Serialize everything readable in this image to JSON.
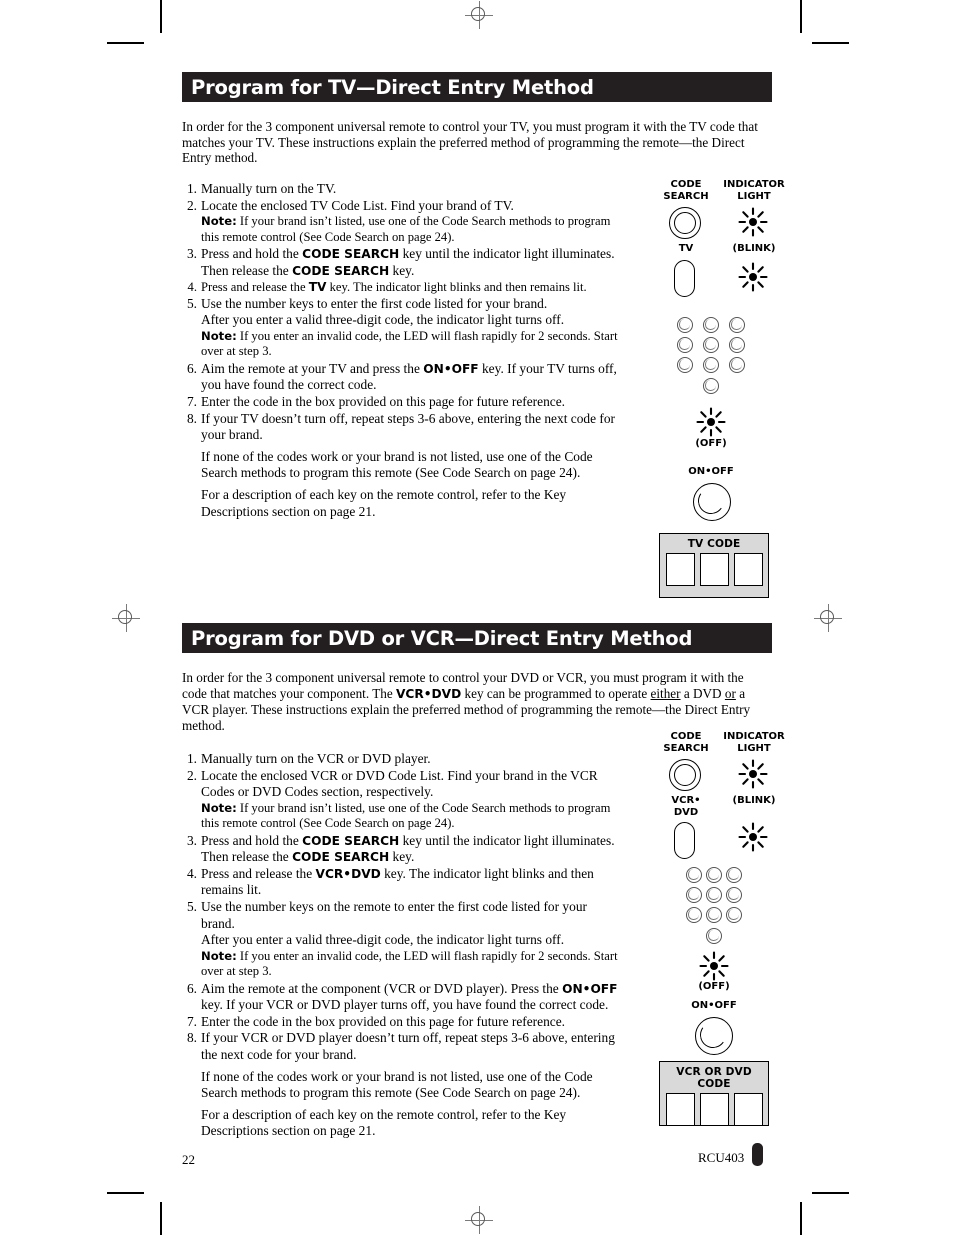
{
  "document": {
    "page_number": "22",
    "model": "RCU403"
  },
  "sections": [
    {
      "id": "tv",
      "header": "Program for TV—Direct Entry Method",
      "intro": "In order for the 3 component universal remote to control your TV, you must program it with the TV code that matches your TV. These instructions explain the preferred method of programming the remote—the Direct Entry method.",
      "steps": [
        {
          "num": "1.",
          "text": "Manually turn on the TV."
        },
        {
          "num": "2.",
          "text": "Locate the enclosed TV Code List. Find your brand of TV."
        },
        {
          "num": "",
          "note_label": "Note:",
          "text": "If your brand isn't listed, use one of the Code Search methods to program this remote control (See Code Search on page 24)."
        },
        {
          "num": "3.",
          "text": "Press and hold the CODE SEARCH key until the indicator light illuminates. Then release the CODE SEARCH key."
        },
        {
          "num": "4.",
          "text": "Press and release the TV key. The indicator light blinks and then remains lit."
        },
        {
          "num": "5.",
          "text": "Use the number keys to enter the first code listed for your brand."
        },
        {
          "num": "",
          "text": "After you enter a valid three-digit code, the indicator light turns off."
        },
        {
          "num": "",
          "note_label": "Note:",
          "text": "If you enter an invalid code, the LED will flash rapidly for 2 seconds. Start over at step 3."
        },
        {
          "num": "6.",
          "text": "Aim the remote at your TV and press the ON•OFF key. If your TV turns off, you have found the correct code."
        },
        {
          "num": "7.",
          "text": "Enter the code in the box provided on this page for future reference."
        },
        {
          "num": "8.",
          "text": "If your TV doesn't turn off, repeat steps 3-6 above, entering the next code for your brand."
        },
        {
          "num": "",
          "text": "If none of the codes work or your brand is not listed, use one of the Code Search methods to program this remote (See Code Search on page 24)."
        },
        {
          "num": "",
          "text": "For a description of each key on the remote control, refer to the Key Descriptions section on page 21."
        }
      ],
      "diagram": {
        "code_search_label": "CODE\nSEARCH",
        "indicator_light_label": "INDICATOR\nLIGHT",
        "device_key_label": "TV",
        "blink_label": "(BLINK)",
        "off_label": "(OFF)",
        "onoff_label": "ON•OFF"
      },
      "codebox": {
        "title": "TV CODE",
        "cells": [
          "",
          "",
          ""
        ]
      }
    },
    {
      "id": "dvd",
      "header": "Program for DVD or VCR—Direct Entry Method",
      "intro": "In order for the 3 component universal remote to control your DVD or VCR, you must program it with the code that matches your component. The VCR•DVD key can be programmed to operate either a DVD or a VCR player. These instructions explain the preferred method of programming the remote—the Direct Entry method.",
      "steps": [
        {
          "num": "1.",
          "text": "Manually turn on the VCR or DVD player."
        },
        {
          "num": "2.",
          "text": "Locate the enclosed VCR or DVD Code List. Find your brand in the VCR Codes or DVD Codes section, respectively."
        },
        {
          "num": "",
          "note_label": "Note:",
          "text": "If your brand isn't listed, use one of the Code Search methods to program this remote control (See Code Search on page 24)."
        },
        {
          "num": "3.",
          "text": "Press and hold the CODE SEARCH key until the indicator light illuminates. Then release the CODE SEARCH key."
        },
        {
          "num": "4.",
          "text": "Press and release the VCR•DVD key. The indicator light blinks and then remains lit."
        },
        {
          "num": "5.",
          "text": "Use the number keys on the remote to enter the first code listed for your brand."
        },
        {
          "num": "",
          "text": "After you enter a valid three-digit code, the indicator light turns off."
        },
        {
          "num": "",
          "note_label": "Note:",
          "text": "If you enter an invalid code, the LED will flash rapidly for 2 seconds. Start over at step 3."
        },
        {
          "num": "6.",
          "text": "Aim the remote at the component (VCR or DVD player). Press the ON•OFF key. If your VCR or DVD player turns off, you have found the correct code."
        },
        {
          "num": "7.",
          "text": "Enter the code in the box provided on this page for future reference."
        },
        {
          "num": "8.",
          "text": "If your VCR or DVD player doesn't turn off, repeat steps 3-6 above, entering the next code for your brand."
        },
        {
          "num": "",
          "text": "If none of the codes work or your brand is not listed, use one of the Code Search methods to program this remote (See Code Search on page 24)."
        },
        {
          "num": "",
          "text": "For a description of each key on the remote control, refer to the Key Descriptions section on page 21."
        }
      ],
      "diagram": {
        "code_search_label": "CODE\nSEARCH",
        "indicator_light_label": "INDICATOR\nLIGHT",
        "device_key_label": "VCR•\nDVD",
        "blink_label": "(BLINK)",
        "off_label": "(OFF)",
        "onoff_label": "ON•OFF"
      },
      "codebox": {
        "title": "VCR OR DVD CODE",
        "cells": [
          "",
          "",
          ""
        ]
      }
    }
  ],
  "colors": {
    "header_bar": "#231f20",
    "codebox_fill": "#d9d9d9",
    "page_bg": "#ffffff"
  }
}
